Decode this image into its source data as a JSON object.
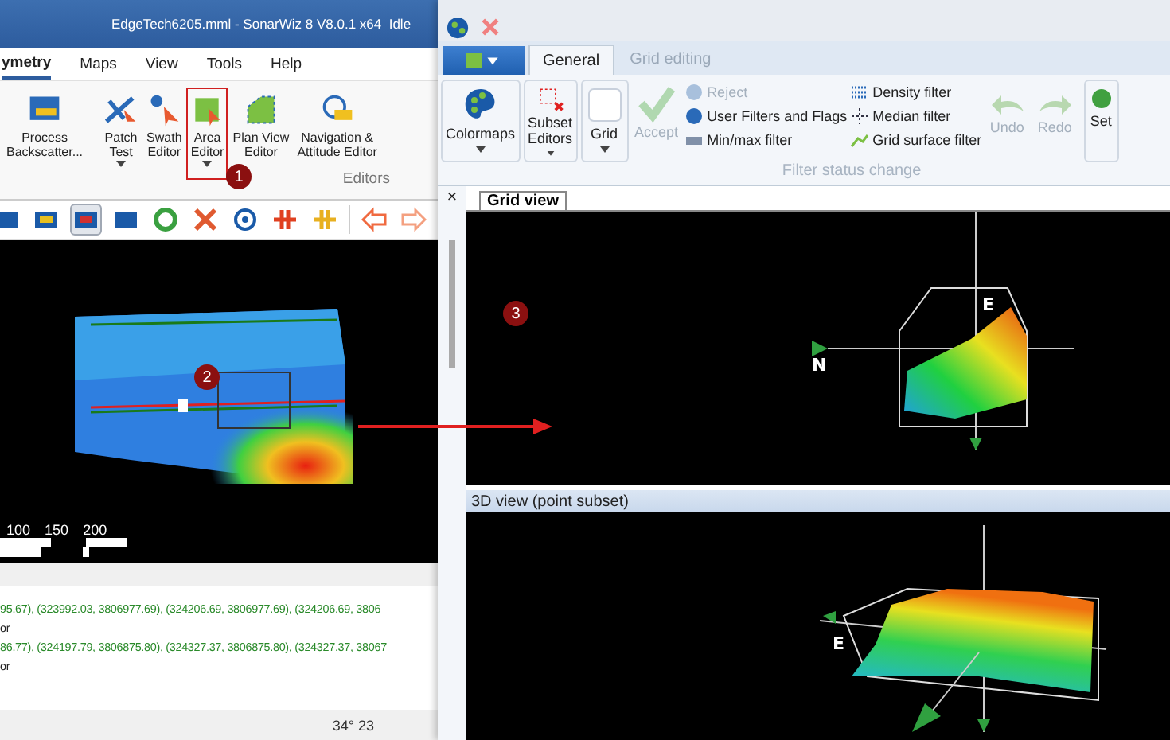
{
  "left_window": {
    "title": "EdgeTech6205.mml - SonarWiz 8 V8.0.1 x64  Idle",
    "menu_tabs": [
      {
        "label": "ymetry",
        "selected": true
      },
      {
        "label": "Maps",
        "selected": false
      },
      {
        "label": "View",
        "selected": false
      },
      {
        "label": "Tools",
        "selected": false
      },
      {
        "label": "Help",
        "selected": false
      }
    ],
    "ribbon": {
      "buttons": [
        {
          "label": "Process\nBackscatter...",
          "dropdown": false,
          "selected": false
        },
        {
          "label": "Patch\nTest",
          "dropdown": true,
          "selected": false
        },
        {
          "label": "Swath\nEditor",
          "dropdown": false,
          "selected": false
        },
        {
          "label": "Area\nEditor",
          "dropdown": true,
          "selected": true
        },
        {
          "label": "Plan View\nEditor",
          "dropdown": false,
          "selected": false
        },
        {
          "label": "Navigation &\nAttitude Editor",
          "dropdown": false,
          "selected": false
        }
      ],
      "group_label": "Editors",
      "callout": "1"
    },
    "toolbar": [
      {
        "selected": false
      },
      {
        "selected": false
      },
      {
        "selected": true
      },
      {
        "selected": false
      },
      {
        "selected": false
      },
      {
        "selected": false
      },
      {
        "selected": false
      },
      {
        "selected": false
      },
      {
        "selected": false
      },
      {
        "selected": false
      },
      {
        "selected": false
      }
    ],
    "map": {
      "callout": "2",
      "scale_labels": [
        "100",
        "150",
        "200"
      ]
    },
    "log_lines": [
      {
        "kind": "coords",
        "text": "95.67), (323992.03, 3806977.69), (324206.69, 3806977.69), (324206.69, 3806"
      },
      {
        "kind": "plain",
        "text": "or"
      },
      {
        "kind": "coords",
        "text": "86.77), (324197.79, 3806875.80), (324327.37, 3806875.80), (324327.37, 38067"
      },
      {
        "kind": "plain",
        "text": "or"
      }
    ],
    "status": "34° 23"
  },
  "right_window": {
    "tabs": [
      {
        "label": "General",
        "selected": true,
        "disabled": false
      },
      {
        "label": "Grid editing",
        "selected": false,
        "disabled": true
      }
    ],
    "large_buttons": [
      {
        "label": "Colormaps",
        "dropdown": true,
        "disabled": false
      },
      {
        "label": "Subset\nEditors",
        "dropdown": true,
        "disabled": false
      },
      {
        "label": "Grid",
        "dropdown": true,
        "disabled": false
      },
      {
        "label": "Accept",
        "dropdown": false,
        "disabled": true
      }
    ],
    "filter_column_1": [
      {
        "label": "Reject",
        "disabled": true
      },
      {
        "label": "User Filters and Flags",
        "disabled": false
      },
      {
        "label": "Min/max filter",
        "disabled": false
      }
    ],
    "filter_column_2": [
      {
        "label": "Density filter",
        "disabled": false
      },
      {
        "label": "Median filter",
        "disabled": false
      },
      {
        "label": "Grid surface filter",
        "disabled": false
      }
    ],
    "history_buttons": [
      {
        "label": "Undo",
        "disabled": true
      },
      {
        "label": "Redo",
        "disabled": true
      }
    ],
    "cut_button": "Set",
    "group_label": "Filter status change",
    "pane_close": "×",
    "grid_view": {
      "tab": "Grid view",
      "callout": "3",
      "axis_labels": [
        "N",
        "E"
      ]
    },
    "view_3d": {
      "title": "3D view (point subset)",
      "axis_label": "E"
    }
  }
}
